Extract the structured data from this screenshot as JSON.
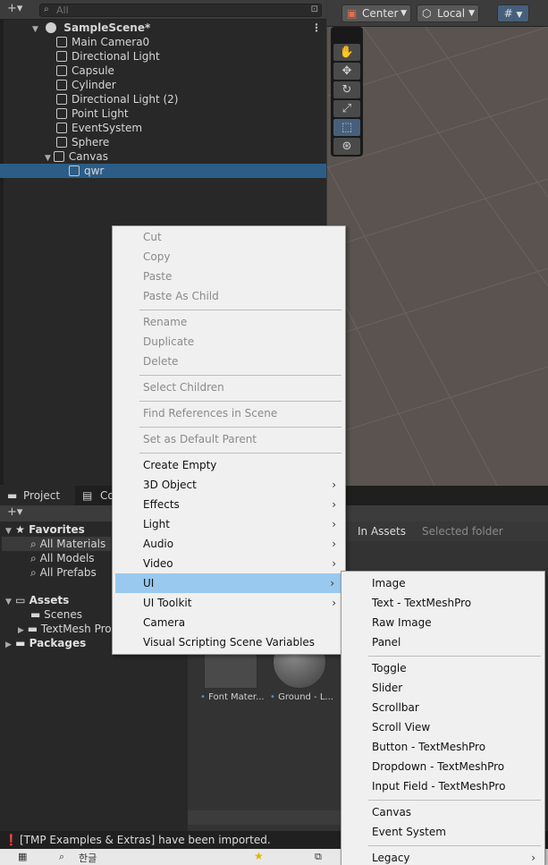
{
  "hierarchy": {
    "search_placeholder": "All",
    "scene_name": "SampleScene*",
    "items": [
      {
        "label": "Main Camera0"
      },
      {
        "label": "Directional Light"
      },
      {
        "label": "Capsule"
      },
      {
        "label": "Cylinder"
      },
      {
        "label": "Directional Light (2)"
      },
      {
        "label": "Point Light"
      },
      {
        "label": "EventSystem"
      },
      {
        "label": "Sphere"
      },
      {
        "label": "Canvas"
      },
      {
        "label": "qwr"
      }
    ]
  },
  "scene_toolbar": {
    "pivot": "Center",
    "space": "Local"
  },
  "project": {
    "tabs": [
      "Project",
      "Co"
    ],
    "favorites_label": "Favorites",
    "favorites": [
      "All Materials",
      "All Models",
      "All Prefabs"
    ],
    "assets_label": "Assets",
    "assets": [
      "Scenes",
      "TextMesh Pro"
    ],
    "packages_label": "Packages",
    "search_scope": [
      "In Assets",
      "Selected folder"
    ],
    "thumbnails": [
      "Font Mater...",
      "Ground - L..."
    ]
  },
  "status_message": "[TMP Examples & Extras] have been imported.",
  "context_menu": {
    "items": [
      "Cut",
      "Copy",
      "Paste",
      "Paste As Child",
      "Rename",
      "Duplicate",
      "Delete",
      "Select Children",
      "Find References in Scene",
      "Set as Default Parent",
      "Create Empty",
      "3D Object",
      "Effects",
      "Light",
      "Audio",
      "Video",
      "UI",
      "UI Toolkit",
      "Camera",
      "Visual Scripting Scene Variables"
    ]
  },
  "ui_submenu": {
    "items": [
      "Image",
      "Text - TextMeshPro",
      "Raw Image",
      "Panel",
      "Toggle",
      "Slider",
      "Scrollbar",
      "Scroll View",
      "Button - TextMeshPro",
      "Dropdown - TextMeshPro",
      "Input Field - TextMeshPro",
      "Canvas",
      "Event System",
      "Legacy"
    ]
  },
  "taskbar": {
    "search_text": "한글"
  }
}
